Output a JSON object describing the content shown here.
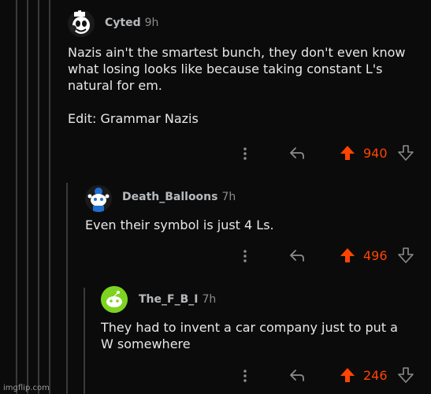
{
  "comments": [
    {
      "username": "Cyted",
      "age": "9h",
      "body": "Nazis ain't the smartest bunch, they don't even know\nwhat losing looks like because taking constant L's\nnatural for em.\n\nEdit: Grammar Nazis",
      "score": "940",
      "icons": {
        "avatar": "cuphead-avatar-icon",
        "more": "more-vertical-icon",
        "reply": "reply-arrow-icon",
        "upvote": "upvote-arrow-icon",
        "downvote": "downvote-arrow-icon"
      }
    },
    {
      "username": "Death_Balloons",
      "age": "7h",
      "body": "Even their symbol is just 4 Ls.",
      "score": "496",
      "icons": {
        "avatar": "snoo-blue-avatar-icon",
        "more": "more-vertical-icon",
        "reply": "reply-arrow-icon",
        "upvote": "upvote-arrow-icon",
        "downvote": "downvote-arrow-icon"
      }
    },
    {
      "username": "The_F_B_I",
      "age": "7h",
      "body": "They had to invent a car company just to put a\nW somewhere",
      "score": "246",
      "icons": {
        "avatar": "snoo-green-avatar-icon",
        "more": "more-vertical-icon",
        "reply": "reply-arrow-icon",
        "upvote": "upvote-arrow-icon",
        "downvote": "downvote-arrow-icon"
      }
    }
  ],
  "colors": {
    "background": "#0b0b0b",
    "upvote": "#ff4500",
    "thread_line": "#3a3a3a"
  },
  "watermark": "imgflip.com"
}
